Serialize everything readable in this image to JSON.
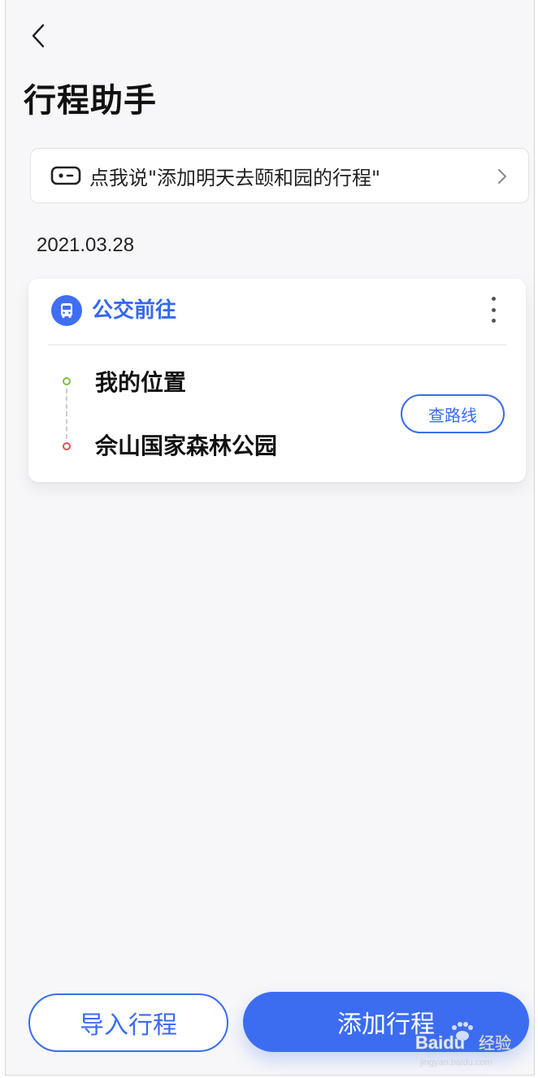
{
  "header": {
    "back_icon": "chevron-left-icon",
    "title": "行程助手"
  },
  "voice_prompt": {
    "icon": "voice-assistant-icon",
    "text": "点我说\"添加明天去颐和园的行程\"",
    "chevron_icon": "chevron-right-icon"
  },
  "trip": {
    "date": "2021.03.28",
    "mode_icon": "bus-icon",
    "mode_label": "公交前往",
    "more_icon": "more-vertical-icon",
    "origin": "我的位置",
    "destination": "佘山国家森林公园",
    "route_button": "查路线"
  },
  "footer": {
    "import_label": "导入行程",
    "add_label": "添加行程"
  },
  "watermark": {
    "brand": "Baidu",
    "label": "经验",
    "url": "jingyan.baidu.com"
  },
  "colors": {
    "accent": "#3c6df1",
    "origin_dot": "#7bc242",
    "destination_dot": "#e05252",
    "background": "#f7f7f9"
  }
}
